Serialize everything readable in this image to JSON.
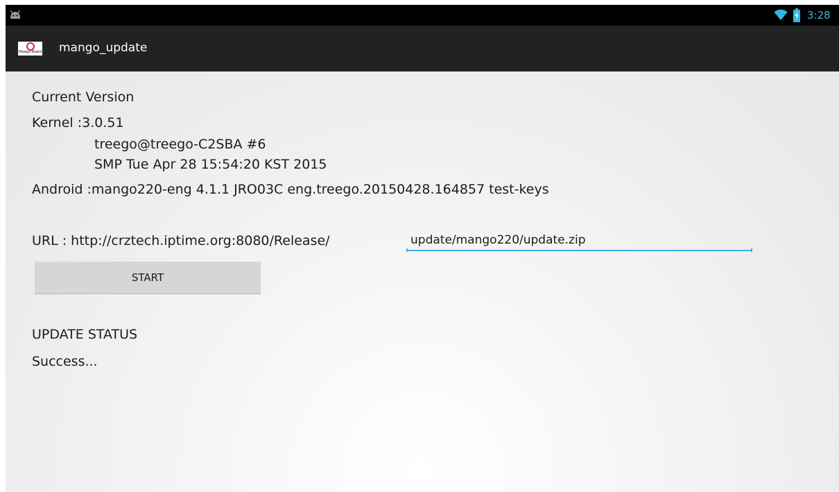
{
  "status_bar": {
    "time": "3:28",
    "icons": [
      "android-notification-icon",
      "wifi-icon",
      "battery-charging-icon"
    ]
  },
  "action_bar": {
    "logo_text": "Mango Board",
    "title": "mango_update"
  },
  "current_version": {
    "heading": "Current Version",
    "kernel_line": "Kernel :3.0.51",
    "kernel_build_user": "treego@treego-C2SBA #6",
    "kernel_build_date": "SMP Tue Apr 28 15:54:20 KST 2015",
    "android_line": "Android :mango220-eng 4.1.1 JRO03C eng.treego.20150428.164857 test-keys"
  },
  "update_form": {
    "url_prefix": "URL : http://crztech.iptime.org:8080/Release/",
    "url_path_value": "update/mango220/update.zip",
    "start_label": "START"
  },
  "update_status": {
    "heading": "UPDATE STATUS",
    "message": "Success..."
  },
  "colors": {
    "accent": "#33b5e5",
    "status_bar_bg": "#000000",
    "action_bar_bg": "#222222",
    "button_bg": "#d6d6d6"
  }
}
